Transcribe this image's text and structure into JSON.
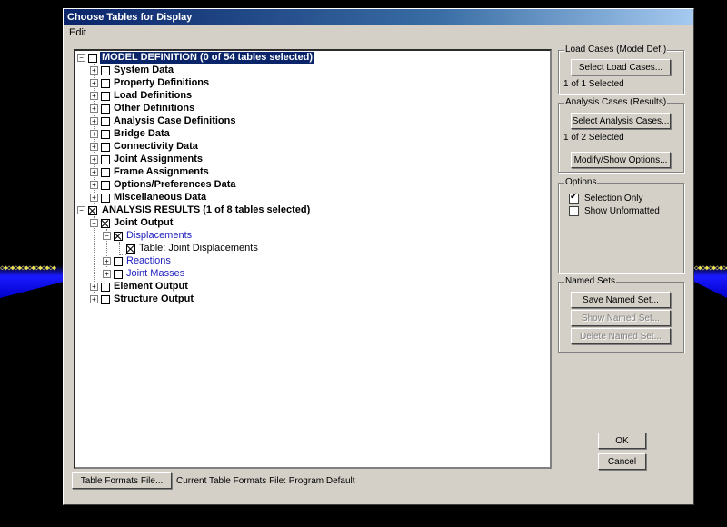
{
  "background": {
    "dots": "◇◆◇◆◇◆◇◆◇◆◇◆◇◆◇◆"
  },
  "window": {
    "title": "Choose Tables for Display"
  },
  "menu": {
    "edit": "Edit"
  },
  "tree": {
    "model_definition": "MODEL DEFINITION  (0 of 54 tables selected)",
    "model_items": [
      "System Data",
      "Property Definitions",
      "Load Definitions",
      "Other Definitions",
      "Analysis Case Definitions",
      "Bridge Data",
      "Connectivity Data",
      "Joint Assignments",
      "Frame Assignments",
      "Options/Preferences Data",
      "Miscellaneous Data"
    ],
    "analysis_results": "ANALYSIS RESULTS  (1 of 8 tables selected)",
    "joint_output": "Joint Output",
    "displacements": "Displacements",
    "table_joint_displacements": "Table:  Joint Displacements",
    "reactions": "Reactions",
    "joint_masses": "Joint Masses",
    "element_output": "Element Output",
    "structure_output": "Structure Output"
  },
  "load_cases": {
    "title": "Load Cases (Model Def.)",
    "button": "Select Load Cases...",
    "status": "1 of 1 Selected"
  },
  "analysis_cases": {
    "title": "Analysis Cases (Results)",
    "button": "Select Analysis Cases...",
    "status": "1 of 2 Selected",
    "options_button": "Modify/Show Options..."
  },
  "options": {
    "title": "Options",
    "selection_only": "Selection Only",
    "selection_only_checked": true,
    "show_unformatted": "Show Unformatted",
    "show_unformatted_checked": false
  },
  "named_sets": {
    "title": "Named Sets",
    "save": "Save Named Set...",
    "show": "Show Named Set...",
    "delete": "Delete Named Set..."
  },
  "footer": {
    "table_formats_button": "Table Formats File...",
    "current_file": "Current Table Formats File:  Program Default"
  },
  "buttons": {
    "ok": "OK",
    "cancel": "Cancel"
  }
}
